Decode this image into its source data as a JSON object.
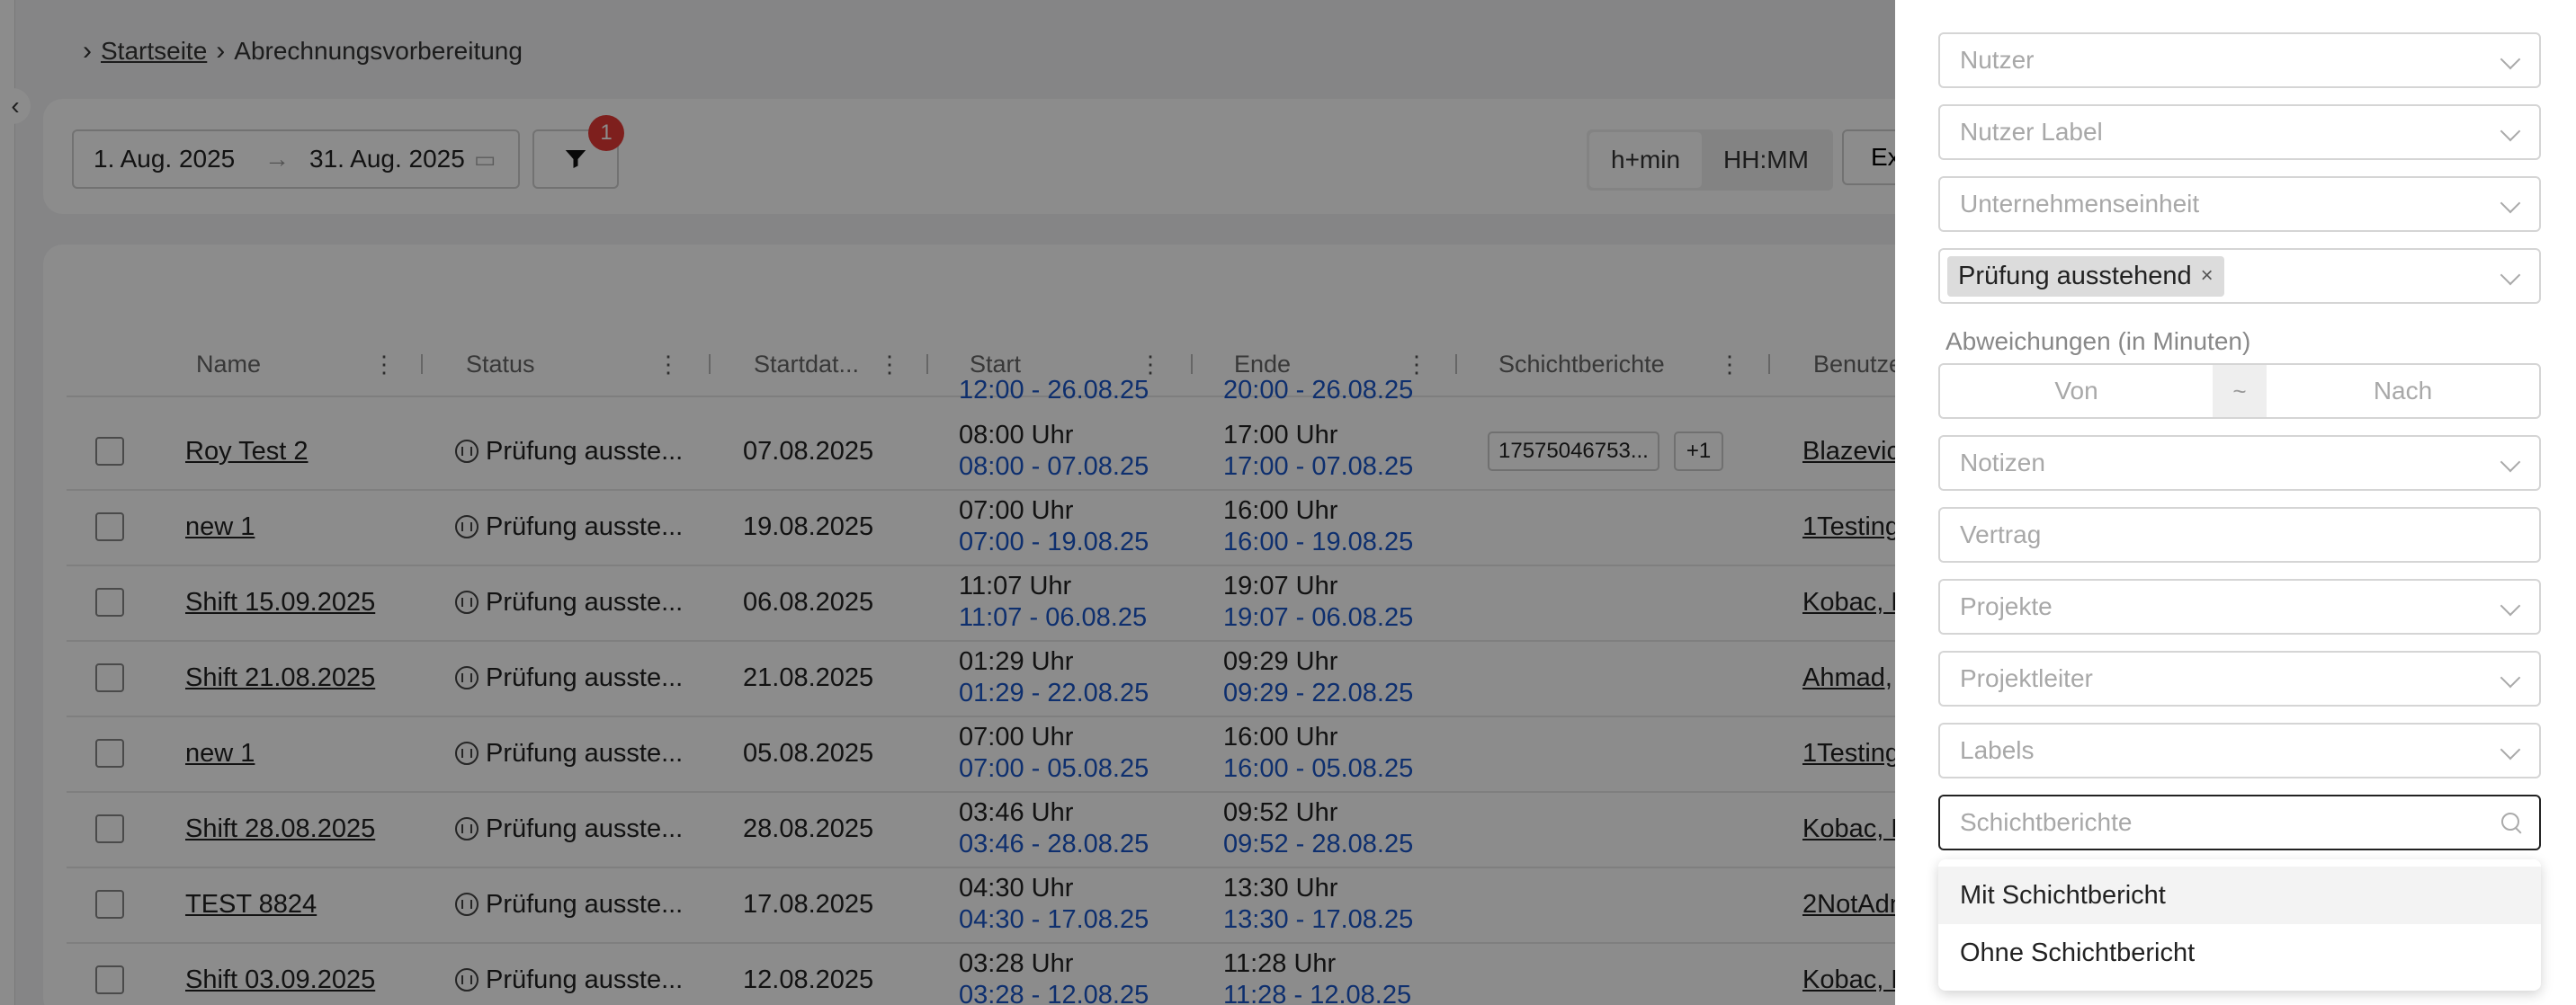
{
  "breadcrumb": {
    "home": "Startseite",
    "current": "Abrechnungsvorbereitung"
  },
  "toolbar": {
    "date_from": "1. Aug. 2025",
    "date_to": "31. Aug. 2025",
    "date_arrow": "→",
    "filter_count": "1",
    "format_hmin": "h+min",
    "format_hhmm": "HH:MM",
    "export_label": "Ex"
  },
  "table": {
    "headers": {
      "name": "Name",
      "status": "Status",
      "startdate": "Startdat...",
      "start": "Start",
      "end": "Ende",
      "reports": "Schichtberichte",
      "user": "Benutze"
    },
    "partial_row": {
      "start": "12:00 - 26.08.25",
      "end": "20:00 - 26.08.25"
    },
    "rows": [
      {
        "name": "Roy Test 2",
        "status": "Prüfung ausste...",
        "date": "07.08.2025",
        "start_time": "08:00 Uhr",
        "start_detail": "08:00 - 07.08.25",
        "end_time": "17:00 Uhr",
        "end_detail": "17:00 - 07.08.25",
        "report_tag": "17575046753...",
        "report_more": "+1",
        "user": "Blazevic"
      },
      {
        "name": "new 1",
        "status": "Prüfung ausste...",
        "date": "19.08.2025",
        "start_time": "07:00 Uhr",
        "start_detail": "07:00 - 19.08.25",
        "end_time": "16:00 Uhr",
        "end_detail": "16:00 - 19.08.25",
        "user": "1Testing"
      },
      {
        "name": "Shift 15.09.2025",
        "status": "Prüfung ausste...",
        "date": "06.08.2025",
        "start_time": "11:07 Uhr",
        "start_detail": "11:07 - 06.08.25",
        "end_time": "19:07 Uhr",
        "end_detail": "19:07 - 06.08.25",
        "user": "Kobac, F"
      },
      {
        "name": "Shift 21.08.2025",
        "status": "Prüfung ausste...",
        "date": "21.08.2025",
        "start_time": "01:29 Uhr",
        "start_detail": "01:29 - 22.08.25",
        "end_time": "09:29 Uhr",
        "end_detail": "09:29 - 22.08.25",
        "user": "Ahmad, "
      },
      {
        "name": "new 1",
        "status": "Prüfung ausste...",
        "date": "05.08.2025",
        "start_time": "07:00 Uhr",
        "start_detail": "07:00 - 05.08.25",
        "end_time": "16:00 Uhr",
        "end_detail": "16:00 - 05.08.25",
        "user": "1Testing"
      },
      {
        "name": "Shift 28.08.2025",
        "status": "Prüfung ausste...",
        "date": "28.08.2025",
        "start_time": "03:46 Uhr",
        "start_detail": "03:46 - 28.08.25",
        "end_time": "09:52 Uhr",
        "end_detail": "09:52 - 28.08.25",
        "user": "Kobac, F"
      },
      {
        "name": "TEST 8824",
        "status": "Prüfung ausste...",
        "date": "17.08.2025",
        "start_time": "04:30 Uhr",
        "start_detail": "04:30 - 17.08.25",
        "end_time": "13:30 Uhr",
        "end_detail": "13:30 - 17.08.25",
        "user": "2NotAdn"
      },
      {
        "name": "Shift 03.09.2025",
        "status": "Prüfung ausste...",
        "date": "12.08.2025",
        "start_time": "03:28 Uhr",
        "start_detail": "03:28 - 12.08.25",
        "end_time": "11:28 Uhr",
        "end_detail": "11:28 - 12.08.25",
        "user": "Kobac, F"
      }
    ]
  },
  "filters": {
    "user": "Nutzer",
    "user_label": "Nutzer Label",
    "unit": "Unternehmenseinheit",
    "status_tag": "Prüfung ausstehend",
    "status_tag_remove": "×",
    "deviation_label": "Abweichungen (in Minuten)",
    "deviation_from": "Von",
    "deviation_sep": "~",
    "deviation_to": "Nach",
    "notes": "Notizen",
    "contract": "Vertrag",
    "projects": "Projekte",
    "project_lead": "Projektleiter",
    "labels": "Labels",
    "reports": "Schichtberichte",
    "report_options": [
      "Mit Schichtbericht",
      "Ohne Schichtbericht"
    ]
  }
}
